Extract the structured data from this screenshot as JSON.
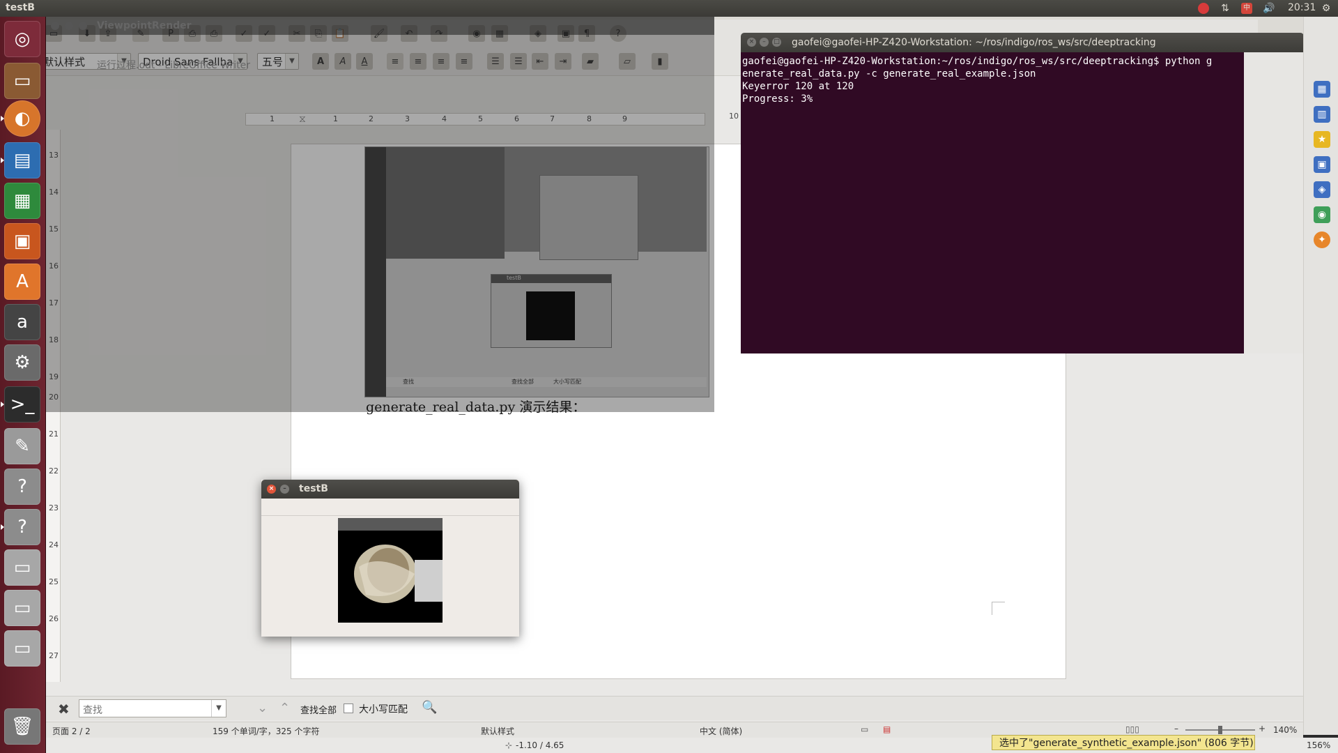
{
  "top_panel": {
    "app_title": "testB",
    "clock": "20:31"
  },
  "launcher": {
    "items": [
      {
        "name": "dash",
        "icon": "ubuntu-logo-icon",
        "color": "#7d2b3a"
      },
      {
        "name": "files",
        "icon": "file-manager-icon",
        "color": "#8a5a33"
      },
      {
        "name": "firefox",
        "icon": "firefox-icon",
        "color": "#d7752b"
      },
      {
        "name": "writer",
        "icon": "libreoffice-writer-icon",
        "color": "#2d6db1"
      },
      {
        "name": "calc",
        "icon": "libreoffice-calc-icon",
        "color": "#2e8a3c"
      },
      {
        "name": "impress",
        "icon": "libreoffice-impress-icon",
        "color": "#c8561e"
      },
      {
        "name": "software-center",
        "icon": "software-center-icon",
        "color": "#e0752b"
      },
      {
        "name": "amazon",
        "icon": "amazon-icon",
        "color": "#444444"
      },
      {
        "name": "system-settings",
        "icon": "settings-wrench-icon",
        "color": "#6a6a6a"
      },
      {
        "name": "terminal",
        "icon": "terminal-icon",
        "color": "#2c2c2c"
      },
      {
        "name": "text-editor",
        "icon": "text-editor-icon",
        "color": "#9a9a9a"
      },
      {
        "name": "unknown-app-1",
        "icon": "question-icon",
        "color": "#8c8c8c"
      },
      {
        "name": "unknown-app-2",
        "icon": "question-icon",
        "color": "#8c8c8c"
      },
      {
        "name": "drive-1",
        "icon": "drive-icon",
        "color": "#a7a7a7"
      },
      {
        "name": "drive-2",
        "icon": "drive-icon",
        "color": "#a7a7a7"
      },
      {
        "name": "drive-3",
        "icon": "drive-icon",
        "color": "#a7a7a7"
      },
      {
        "name": "trash",
        "icon": "trash-icon",
        "color": "#777777"
      }
    ]
  },
  "viewpoint_window": {
    "title": "ViewpointRender"
  },
  "writer": {
    "window_title": "运行过程.odt - LibreOffice Writer",
    "paragraph_style": "默认样式",
    "font_name": "Droid Sans Fallbacl",
    "font_size": "五号",
    "ruler_h": [
      "1",
      "1",
      "2",
      "3",
      "4",
      "5",
      "6",
      "7",
      "8",
      "9",
      "10"
    ],
    "ruler_v": [
      "13",
      "14",
      "15",
      "16",
      "17",
      "18",
      "19",
      "20",
      "21",
      "22",
      "23",
      "24",
      "25",
      "26",
      "27"
    ],
    "caption": "generate_real_data.py 演示结果：",
    "embedded_find_label": "查找",
    "embedded_find_all": "查找全部",
    "embedded_match_case": "大小写匹配",
    "embedded_testb_title": "testB"
  },
  "terminal": {
    "title": "gaofei@gaofei-HP-Z420-Workstation: ~/ros/indigo/ros_ws/src/deeptracking",
    "lines": [
      "gaofei@gaofei-HP-Z420-Workstation:~/ros/indigo/ros_ws/src/deeptracking$ python g",
      "enerate_real_data.py -c generate_real_example.json",
      "Keyerror 120 at 120",
      "Progress: 3%"
    ]
  },
  "testb_window": {
    "title": "testB"
  },
  "findbar": {
    "placeholder": "查找",
    "find_all": "查找全部",
    "match_case": "大小写匹配"
  },
  "statusbar": {
    "page": "页面 2 / 2",
    "words": "159 个单词/字，325 个字符",
    "style": "默认样式",
    "language": "中文 (简体)",
    "zoom": "140%"
  },
  "statusbar2": {
    "coords": "-1.10 / 4.65",
    "zoom": "156%",
    "tooltip": "选中了\"generate_synthetic_example.json\" (806 字节)"
  },
  "colors": {
    "terminal_bg": "#300a24",
    "launcher_bg": "#6e2530",
    "panel_bg": "#3b3a36"
  }
}
